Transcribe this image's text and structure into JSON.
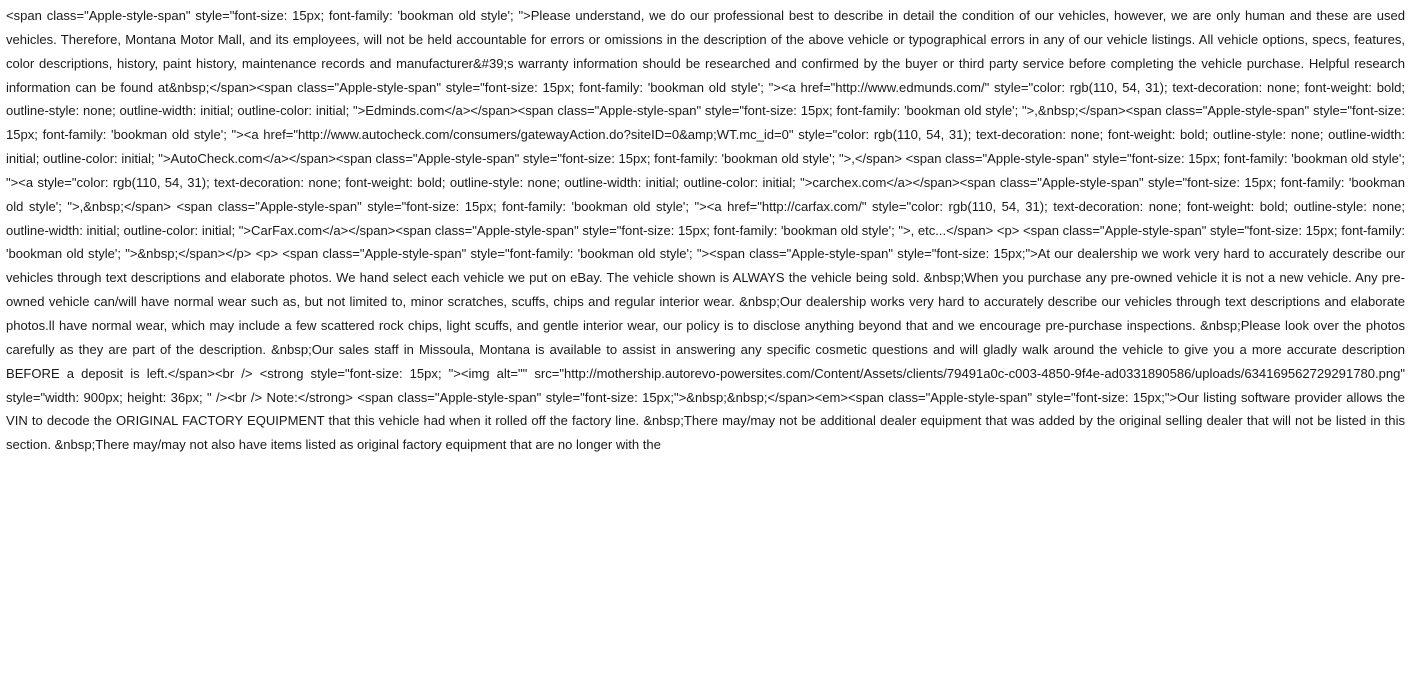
{
  "document": {
    "raw_text": "<span class=\"Apple-style-span\" style=\"font-size: 15px; font-family: 'bookman old style'; \">Please understand, we do our professional best to describe in detail the condition of our vehicles, however, we are only human and these are used vehicles. Therefore, Montana Motor Mall, and its employees, will not be held accountable for errors or omissions in the description of the above vehicle or typographical errors in any of our vehicle listings. All vehicle options, specs, features, color descriptions, history, paint history, maintenance records and manufacturer&#39;s warranty information should be researched and confirmed by the buyer or third party service before completing the vehicle purchase. Helpful research information can be found at&nbsp;</span><span class=\"Apple-style-span\" style=\"font-size: 15px; font-family: 'bookman old style'; \"><a href=\"http://www.edmunds.com/\" style=\"color: rgb(110, 54, 31); text-decoration: none; font-weight: bold; outline-style: none; outline-width: initial; outline-color: initial; \">Edminds.com</a></span><span class=\"Apple-style-span\" style=\"font-size: 15px; font-family: 'bookman old style'; \">,&nbsp;</span><span class=\"Apple-style-span\" style=\"font-size: 15px; font-family: 'bookman old style'; \"><a href=\"http://www.autocheck.com/consumers/gatewayAction.do?siteID=0&amp;WT.mc_id=0\" style=\"color: rgb(110, 54, 31); text-decoration: none; font-weight: bold; outline-style: none; outline-width: initial; outline-color: initial; \">AutoCheck.com</a></span><span class=\"Apple-style-span\" style=\"font-size: 15px; font-family: 'bookman old style'; \">,</span> <span class=\"Apple-style-span\" style=\"font-size: 15px; font-family: 'bookman old style'; \"><a style=\"color: rgb(110, 54, 31); text-decoration: none; font-weight: bold; outline-style: none; outline-width: initial; outline-color: initial; \">carchex.com</a></span><span class=\"Apple-style-span\" style=\"font-size: 15px; font-family: 'bookman old style'; \">,&nbsp;</span> <span class=\"Apple-style-span\" style=\"font-size: 15px; font-family: 'bookman old style'; \"><a href=\"http://carfax.com/\" style=\"color: rgb(110, 54, 31); text-decoration: none; font-weight: bold; outline-style: none; outline-width: initial; outline-color: initial; \">CarFax.com</a></span><span class=\"Apple-style-span\" style=\"font-size: 15px; font-family: 'bookman old style'; \">, etc...</span> <p> <span class=\"Apple-style-span\" style=\"font-size: 15px; font-family: 'bookman old style'; \">&nbsp;</span></p> <p> <span class=\"Apple-style-span\" style=\"font-family: 'bookman old style'; \"><span class=\"Apple-style-span\" style=\"font-size: 15px;\">At our dealership we work very hard to accurately describe our vehicles through text descriptions and elaborate photos. We hand select each vehicle we put on eBay. The vehicle shown is ALWAYS the vehicle being sold. &nbsp;When you purchase any pre-owned vehicle it is not a new vehicle. Any pre-owned vehicle can/will have normal wear such as, but not limited to, minor scratches, scuffs, chips and regular interior wear. &nbsp;Our dealership works very hard to accurately describe our vehicles through text descriptions and elaborate photos.ll have normal wear, which may include a few scattered rock chips, light scuffs, and gentle interior wear, our policy is to disclose anything beyond that and we encourage pre-purchase inspections. &nbsp;Please look over the photos carefully as they are part of the description. &nbsp;Our sales staff in Missoula, Montana is available to assist in answering any specific cosmetic questions and will gladly walk around the vehicle to give you a more accurate description BEFORE a deposit is left.</span><br /> <strong style=\"font-size: 15px; \"><img alt=\"\" src=\"http://mothership.autorevo-powersites.com/Content/Assets/clients/79491a0c-c003-4850-9f4e-ad0331890586/uploads/634169562729291780.png\" style=\"width: 900px; height: 36px; \" /><br /> Note:</strong> <span class=\"Apple-style-span\" style=\"font-size: 15px;\">&nbsp;&nbsp;</span><em><span class=\"Apple-style-span\" style=\"font-size: 15px;\">Our listing software provider allows the VIN to decode the ORIGINAL FACTORY EQUIPMENT that this vehicle had when it rolled off the factory line. &nbsp;There may/may not be additional dealer equipment that was added by the original selling dealer that will not be listed in this section. &nbsp;There may/may not also have items listed as original factory equipment that are no longer with the"
  }
}
